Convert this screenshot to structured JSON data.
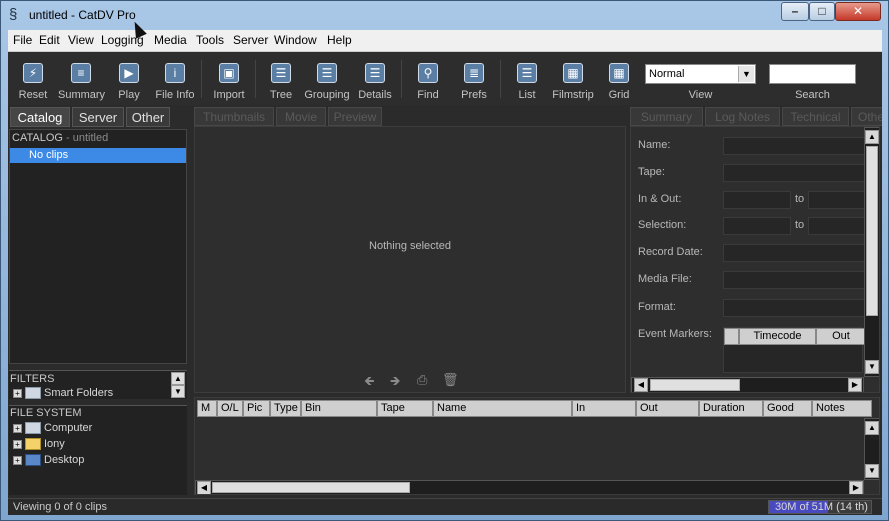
{
  "window": {
    "title": "untitled - CatDV Pro",
    "buttons": {
      "minimize": "–",
      "maximize": "□",
      "close": "✕"
    }
  },
  "menu": [
    "File",
    "Edit",
    "View",
    "Logging",
    "Media",
    "Tools",
    "Server",
    "Window",
    "Help"
  ],
  "toolbar": {
    "buttons": [
      {
        "label": "Reset",
        "icon": "reset-icon",
        "glyph": "⚡"
      },
      {
        "label": "Summary",
        "icon": "summary-icon",
        "glyph": "≡"
      },
      {
        "label": "Play",
        "icon": "play-icon",
        "glyph": "▶"
      },
      {
        "label": "File Info",
        "icon": "file-info-icon",
        "glyph": "i"
      },
      {
        "label": "Import",
        "icon": "import-icon",
        "glyph": "▣"
      },
      {
        "label": "Tree",
        "icon": "tree-icon",
        "glyph": "☰"
      },
      {
        "label": "Grouping",
        "icon": "grouping-icon",
        "glyph": "☰"
      },
      {
        "label": "Details",
        "icon": "details-icon",
        "glyph": "☰"
      },
      {
        "label": "Find",
        "icon": "find-icon",
        "glyph": "⚲"
      },
      {
        "label": "Prefs",
        "icon": "prefs-icon",
        "glyph": "≣"
      },
      {
        "label": "List",
        "icon": "list-icon",
        "glyph": "☰"
      },
      {
        "label": "Filmstrip",
        "icon": "filmstrip-icon",
        "glyph": "▦"
      },
      {
        "label": "Grid",
        "icon": "grid-icon",
        "glyph": "▦"
      }
    ],
    "view_select": {
      "value": "Normal",
      "label": "View"
    },
    "search": {
      "label": "Search",
      "value": ""
    }
  },
  "left_panel": {
    "tabs": [
      "Catalog",
      "Server",
      "Other"
    ],
    "catalog_header": "CATALOG",
    "catalog_name": " - untitled",
    "selected_item": "No clips",
    "filters": {
      "title": "FILTERS",
      "items": [
        "Smart Folders"
      ]
    },
    "file_system": {
      "title": "FILE SYSTEM",
      "items": [
        "Computer",
        "Iony",
        "Desktop"
      ]
    }
  },
  "center_panel": {
    "tabs": [
      "Thumbnails",
      "Movie",
      "Preview"
    ],
    "empty_message": "Nothing selected",
    "nav_glyphs": {
      "back": "🡸",
      "forward": "🡺",
      "capture": "⎙",
      "delete": "🗑"
    }
  },
  "right_panel": {
    "tabs": [
      "Summary",
      "Log Notes",
      "Technical",
      "Othe"
    ],
    "fields": {
      "name": "Name:",
      "tape": "Tape:",
      "in_out": "In & Out:",
      "selection": "Selection:",
      "record_date": "Record Date:",
      "media_file": "Media File:",
      "format": "Format:",
      "event_markers": "Event Markers:"
    },
    "to_label": "to",
    "event_marker_columns": [
      "",
      "Timecode",
      "Out"
    ]
  },
  "clip_table": {
    "columns": [
      "M",
      "O/L",
      "Pic",
      "Type",
      "Bin",
      "Tape",
      "Name",
      "In",
      "Out",
      "Duration",
      "Good",
      "Notes"
    ]
  },
  "status": {
    "text": "Viewing 0 of 0 clips",
    "memory": "30M of 51M (14 th)",
    "memory_fraction": 0.58
  }
}
